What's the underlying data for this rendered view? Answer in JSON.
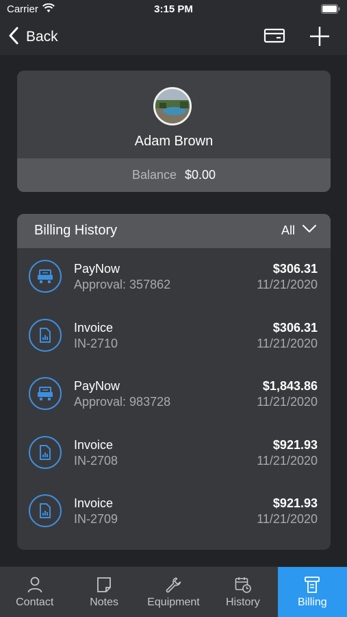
{
  "status_bar": {
    "carrier": "Carrier",
    "time": "3:15 PM"
  },
  "nav": {
    "back_label": "Back"
  },
  "customer": {
    "name": "Adam Brown",
    "balance_label": "Balance",
    "balance_value": "$0.00"
  },
  "billing": {
    "title": "Billing History",
    "filter_label": "All",
    "items": [
      {
        "icon": "paynow-icon",
        "title": "PayNow",
        "subtitle": "Approval: 357862",
        "amount": "$306.31",
        "date": "11/21/2020"
      },
      {
        "icon": "invoice-icon",
        "title": "Invoice",
        "subtitle": "IN-2710",
        "amount": "$306.31",
        "date": "11/21/2020"
      },
      {
        "icon": "paynow-icon",
        "title": "PayNow",
        "subtitle": "Approval: 983728",
        "amount": "$1,843.86",
        "date": "11/21/2020"
      },
      {
        "icon": "invoice-icon",
        "title": "Invoice",
        "subtitle": "IN-2708",
        "amount": "$921.93",
        "date": "11/21/2020"
      },
      {
        "icon": "invoice-icon",
        "title": "Invoice",
        "subtitle": "IN-2709",
        "amount": "$921.93",
        "date": "11/21/2020"
      }
    ]
  },
  "tabs": [
    {
      "label": "Contact",
      "icon": "person-icon"
    },
    {
      "label": "Notes",
      "icon": "note-icon"
    },
    {
      "label": "Equipment",
      "icon": "wrench-icon"
    },
    {
      "label": "History",
      "icon": "calendar-clock-icon"
    },
    {
      "label": "Billing",
      "icon": "billing-icon",
      "active": true
    }
  ],
  "colors": {
    "accent": "#2d98f0",
    "icon_ring": "#3d8fe0",
    "background": "#222326"
  }
}
